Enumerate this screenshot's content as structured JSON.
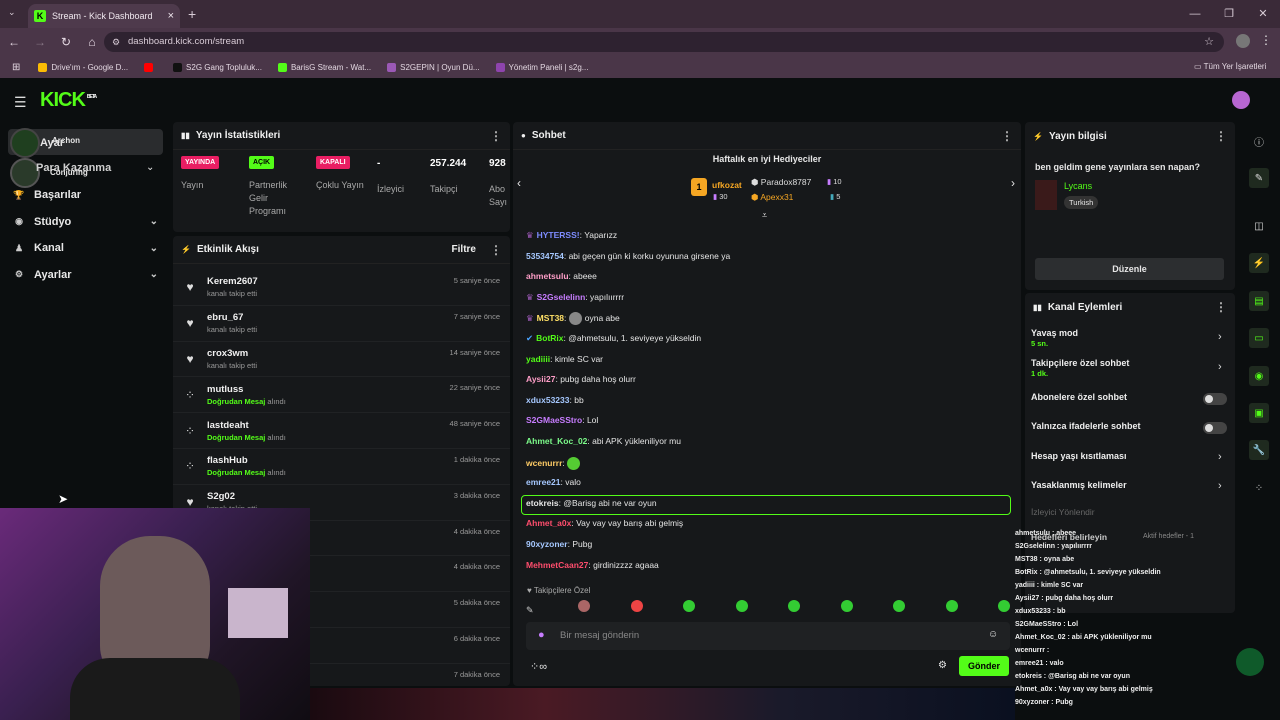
{
  "browser": {
    "tab_title": "Stream - Kick Dashboard",
    "url": "dashboard.kick.com/stream",
    "bookmarks": [
      {
        "label": "Drive'ım - Google D...",
        "color": "#fbbc05"
      },
      {
        "label": "",
        "color": "#ff0000"
      },
      {
        "label": "S2G Gang Topluluk...",
        "color": "#111111"
      },
      {
        "label": "BarisG Stream - Wat...",
        "color": "#53fc18"
      },
      {
        "label": "S2GEPIN | Oyun Dü...",
        "color": "#9b59b6"
      },
      {
        "label": "Yönetim Paneli | s2g...",
        "color": "#8e44ad"
      }
    ],
    "all_bookmarks": "Tüm Yer İşaretleri"
  },
  "brand": {
    "logo": "KICK",
    "sup": "BETA",
    "accent": "#53fc18"
  },
  "sidebar": {
    "overlap1": "Ayar",
    "overlap2": "Archon",
    "overlap3": "Para Kazanma",
    "overlap4": "Conjuring",
    "items": [
      {
        "label": "Başarılar",
        "icon": "trophy-icon",
        "chev": ""
      },
      {
        "label": "Stüdyo",
        "icon": "studio-icon",
        "chev": "⌄"
      },
      {
        "label": "Kanal",
        "icon": "channel-icon",
        "chev": "⌄"
      },
      {
        "label": "Ayarlar",
        "icon": "gear-icon",
        "chev": "⌄"
      }
    ]
  },
  "stats": {
    "title": "Yayın İstatistikleri",
    "items": [
      {
        "badge": "YAYINDA",
        "badge_color": "#e91e63",
        "label": "Yayın"
      },
      {
        "badge": "AÇIK",
        "badge_color": "#53fc18",
        "label": "Partnerlik Gelir Programı"
      },
      {
        "badge": "KAPALI",
        "badge_color": "#e91e63",
        "label": "Çoklu Yayın"
      },
      {
        "value": "-",
        "label": "İzleyici"
      },
      {
        "value": "257.244",
        "label": "Takipçi"
      },
      {
        "value": "928",
        "label": "Abo Sayı"
      }
    ]
  },
  "events": {
    "title": "Etkinlik Akışı",
    "filter": "Filtre",
    "rows": [
      {
        "name": "Kerem2607",
        "sub": "kanalı takip etti",
        "hl": "",
        "time": "5 saniye önce",
        "icon": "heart-icon"
      },
      {
        "name": "ebru_67",
        "sub": "kanalı takip etti",
        "hl": "",
        "time": "7 saniye önce",
        "icon": "heart-icon"
      },
      {
        "name": "crox3wm",
        "sub": "kanalı takip etti",
        "hl": "",
        "time": "14 saniye önce",
        "icon": "heart-icon"
      },
      {
        "name": "mutluss",
        "sub": " alındı",
        "hl": "Doğrudan Mesaj",
        "time": "22 saniye önce",
        "icon": "gift-icon"
      },
      {
        "name": "lastdeaht",
        "sub": " alındı",
        "hl": "Doğrudan Mesaj",
        "time": "48 saniye önce",
        "icon": "gift-icon"
      },
      {
        "name": "flashHub",
        "sub": " alındı",
        "hl": "Doğrudan Mesaj",
        "time": "1 dakika önce",
        "icon": "gift-icon"
      },
      {
        "name": "S2g02",
        "sub": "kanalı takip etti",
        "hl": "",
        "time": "3 dakika önce",
        "icon": "heart-icon"
      },
      {
        "name": "",
        "sub": "",
        "hl": "",
        "time": "4 dakika önce",
        "icon": ""
      },
      {
        "name": "",
        "sub": "",
        "hl": "",
        "time": "4 dakika önce",
        "icon": ""
      },
      {
        "name": "",
        "sub": "",
        "hl": "",
        "time": "5 dakika önce",
        "icon": ""
      },
      {
        "name": "",
        "sub": "",
        "hl": "",
        "time": "6 dakika önce",
        "icon": ""
      },
      {
        "name": "",
        "sub": "",
        "hl": "",
        "time": "7 dakika önce",
        "icon": ""
      }
    ]
  },
  "chat": {
    "title": "Sohbet",
    "gifter_title": "Haftalık en iyi Hediyeciler",
    "gifters": [
      {
        "name": "ufkozat",
        "count": "30",
        "rank": "1"
      },
      {
        "name": "Paradox8787",
        "count": "10"
      },
      {
        "name": "Apexx31",
        "count": "5"
      }
    ],
    "messages": [
      {
        "user": "HYTERSS!",
        "color": "#7e8cff",
        "text": "Yaparızz"
      },
      {
        "user": "53534754",
        "color": "#a6c8ff",
        "text": "abi geçen gün ki korku oyununa girsene ya"
      },
      {
        "user": "ahmetsulu",
        "color": "#ff9ec8",
        "text": "abeee"
      },
      {
        "user": "S2Gselelinn",
        "color": "#c77dff",
        "text": "yapılıırrrr"
      },
      {
        "user": "MST38",
        "color": "#ffe066",
        "text": "oyna abe"
      },
      {
        "user": "BotRix",
        "color": "#53fc18",
        "text": "@ahmetsulu, 1. seviyeye yükseldin"
      },
      {
        "user": "yadiiii",
        "color": "#53fc18",
        "text": "kimle SC var"
      },
      {
        "user": "Aysii27",
        "color": "#ff9ec8",
        "text": "pubg daha hoş olurr"
      },
      {
        "user": "xdux53233",
        "color": "#a6c8ff",
        "text": "bb"
      },
      {
        "user": "S2GMaeSStro",
        "color": "#c77dff",
        "text": "Lol"
      },
      {
        "user": "Ahmet_Koc_02",
        "color": "#7cfc8a",
        "text": "abi APK yükleniliyor mu"
      },
      {
        "user": "wcenurrr",
        "color": "#ffcc66",
        "text": ""
      },
      {
        "user": "emree21",
        "color": "#a6c8ff",
        "text": "valo"
      },
      {
        "user": "etokreis",
        "color": "#e6e6e6",
        "text": "@Barisg abi ne var oyun"
      },
      {
        "user": "Ahmet_a0x",
        "color": "#ff4d6d",
        "text": "Vay vay vay barış abi gelmiş"
      },
      {
        "user": "90xyzoner",
        "color": "#a6c8ff",
        "text": "Pubg"
      },
      {
        "user": "MehmetCaan27",
        "color": "#ff4d6d",
        "text": "girdinizzzz agaaa"
      }
    ],
    "mode": "Takipçilere Özel",
    "placeholder": "Bir mesaj gönderin",
    "send": "Gönder"
  },
  "info": {
    "title": "Yayın bilgisi",
    "stream_title": "ben geldim gene yayınlara sen napan?",
    "category": "Lycans",
    "tag": "Turkish",
    "edit": "Düzenle"
  },
  "actions": {
    "title": "Kanal Eylemleri",
    "rows": [
      {
        "label": "Yavaş mod",
        "sub": "5 sn.",
        "kind": "chev"
      },
      {
        "label": "Takipçilere özel sohbet",
        "sub": "1 dk.",
        "kind": "chev"
      },
      {
        "label": "Abonelere özel sohbet",
        "sub": "",
        "kind": "toggle"
      },
      {
        "label": "Yalnızca ifadelerle sohbet",
        "sub": "",
        "kind": "toggle"
      },
      {
        "label": "Hesap yaşı kısıtlaması",
        "sub": "",
        "kind": "chev"
      },
      {
        "label": "Yasaklanmış kelimeler",
        "sub": "",
        "kind": "chev"
      }
    ],
    "faded": "İzleyici Yönlendir",
    "goals": "Hedefleri belirleyin",
    "goals_sub": "Aktif hedefler - 1"
  },
  "overlay": [
    "ahmetsulu : abeee",
    "S2Gselelinn : yapılıırrrr",
    "MST38 : oyna abe",
    "BotRix : @ahmetsulu, 1. seviyeye yükseldin",
    "yadiiii : kimle SC var",
    "Aysii27 : pubg daha hoş olurr",
    "xdux53233 : bb",
    "S2GMaeSStro : Lol",
    "Ahmet_Koc_02 : abi APK yükleniliyor mu",
    "wcenurrr :",
    "emree21 : valo",
    "etokreis : @Barisg abi ne var oyun",
    "Ahmet_a0x : Vay vay vay barış abi gelmiş",
    "90xyzoner : Pubg"
  ]
}
